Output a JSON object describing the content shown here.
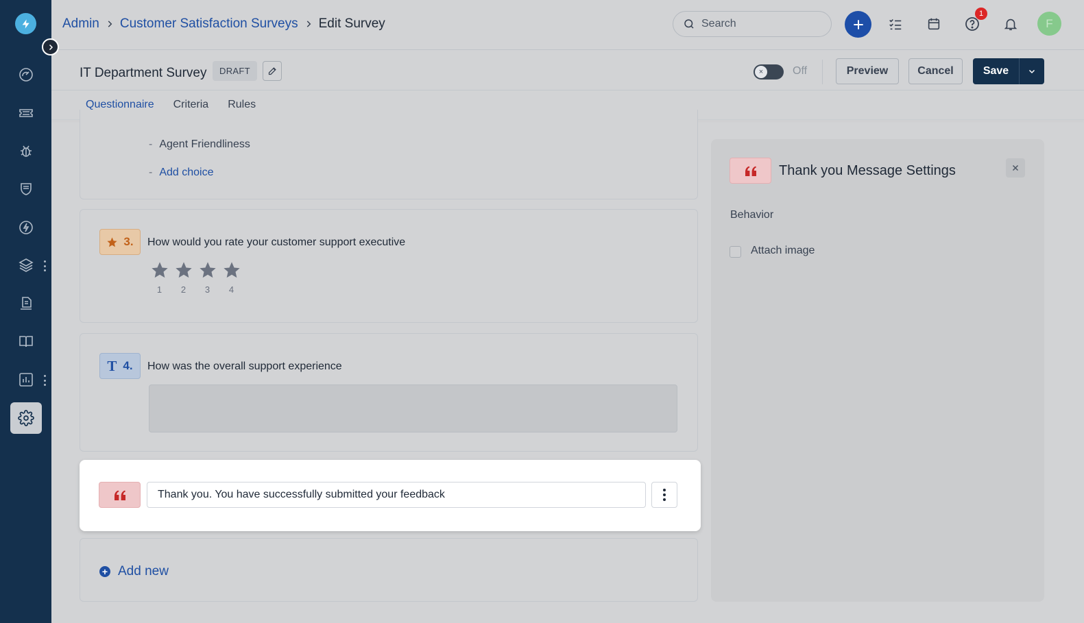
{
  "breadcrumb": {
    "items": [
      "Admin",
      "Customer Satisfaction Surveys"
    ],
    "current": "Edit Survey"
  },
  "search": {
    "placeholder": "Search"
  },
  "header": {
    "help_badge": "1",
    "avatar_initial": "F"
  },
  "survey": {
    "title": "IT Department Survey",
    "status": "DRAFT",
    "toggle_label": "Off",
    "toggle_on": false,
    "preview_label": "Preview",
    "cancel_label": "Cancel",
    "save_label": "Save"
  },
  "tabs": [
    {
      "label": "Questionnaire",
      "active": true
    },
    {
      "label": "Criteria",
      "active": false
    },
    {
      "label": "Rules",
      "active": false
    }
  ],
  "choices": {
    "visible_choice": "Agent Friendliness",
    "add_choice_label": "Add choice"
  },
  "questions": [
    {
      "number": "3.",
      "type": "rating",
      "text": "How would you rate your customer support executive",
      "scale": [
        "1",
        "2",
        "3",
        "4"
      ]
    },
    {
      "number": "4.",
      "type": "text",
      "type_icon": "T",
      "text": "How was the overall support experience"
    }
  ],
  "thank_you": {
    "message": "Thank you. You have successfully submitted your feedback"
  },
  "add_new_label": "Add new",
  "panel": {
    "title": "Thank you Message Settings",
    "section": "Behavior",
    "attach_image_label": "Attach image",
    "attach_image_checked": false
  },
  "colors": {
    "sidebar": "#14304d",
    "accent": "#1f4fa3",
    "rating_accent": "#c2621a",
    "quote_accent": "#c62828",
    "badge_red": "#dc2626"
  }
}
